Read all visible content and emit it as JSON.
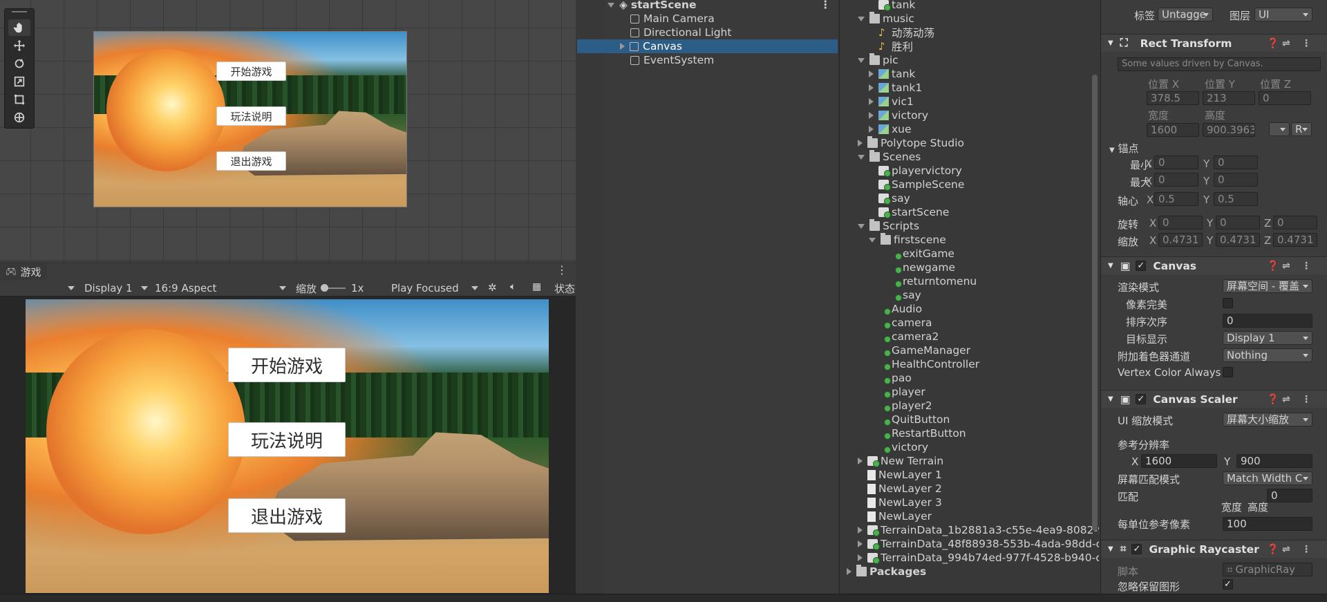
{
  "scene_view": {
    "buttons": [
      "开始游戏",
      "玩法说明",
      "退出游戏"
    ]
  },
  "game_view": {
    "tab_label": "游戏",
    "display": "Display 1",
    "aspect": "16:9 Aspect",
    "scale_label": "缩放",
    "scale_value": "1x",
    "play_mode": "Play Focused",
    "stats_label": "状态",
    "buttons": [
      "开始游戏",
      "玩法说明",
      "退出游戏"
    ]
  },
  "hierarchy": {
    "scene": "startScene",
    "items": [
      "Main Camera",
      "Directional Light",
      "Canvas",
      "EventSystem"
    ],
    "selected": "Canvas"
  },
  "project": {
    "items": [
      {
        "label": "tank",
        "type": "scene",
        "depth": 2
      },
      {
        "label": "music",
        "type": "folder",
        "depth": 1,
        "open": true
      },
      {
        "label": "动荡动荡",
        "type": "audio",
        "depth": 2
      },
      {
        "label": "胜利",
        "type": "audio",
        "depth": 2
      },
      {
        "label": "pic",
        "type": "folder",
        "depth": 1,
        "open": true
      },
      {
        "label": "tank",
        "type": "img",
        "depth": 2,
        "closed": true
      },
      {
        "label": "tank1",
        "type": "img",
        "depth": 2,
        "closed": true
      },
      {
        "label": "vic1",
        "type": "img",
        "depth": 2,
        "closed": true
      },
      {
        "label": "victory",
        "type": "img",
        "depth": 2,
        "closed": true
      },
      {
        "label": "xue",
        "type": "img",
        "depth": 2,
        "closed": true
      },
      {
        "label": "Polytope Studio",
        "type": "folder",
        "depth": 1,
        "closed": true
      },
      {
        "label": "Scenes",
        "type": "folder",
        "depth": 1,
        "open": true
      },
      {
        "label": "playervictory",
        "type": "scene",
        "depth": 2
      },
      {
        "label": "SampleScene",
        "type": "scene",
        "depth": 2
      },
      {
        "label": "say",
        "type": "scene",
        "depth": 2
      },
      {
        "label": "startScene",
        "type": "scene",
        "depth": 2
      },
      {
        "label": "Scripts",
        "type": "folder",
        "depth": 1,
        "open": true
      },
      {
        "label": "firstscene",
        "type": "folder",
        "depth": 2,
        "open": true
      },
      {
        "label": "exitGame",
        "type": "script",
        "depth": 3
      },
      {
        "label": "newgame",
        "type": "script",
        "depth": 3
      },
      {
        "label": "returntomenu",
        "type": "script",
        "depth": 3
      },
      {
        "label": "say",
        "type": "script",
        "depth": 3
      },
      {
        "label": "Audio",
        "type": "script",
        "depth": 2
      },
      {
        "label": "camera",
        "type": "script",
        "depth": 2
      },
      {
        "label": "camera2",
        "type": "script",
        "depth": 2
      },
      {
        "label": "GameManager",
        "type": "script",
        "depth": 2
      },
      {
        "label": "HealthController",
        "type": "script",
        "depth": 2
      },
      {
        "label": "pao",
        "type": "script",
        "depth": 2
      },
      {
        "label": "player",
        "type": "script",
        "depth": 2
      },
      {
        "label": "player2",
        "type": "script",
        "depth": 2
      },
      {
        "label": "QuitButton",
        "type": "script",
        "depth": 2
      },
      {
        "label": "RestartButton",
        "type": "script",
        "depth": 2
      },
      {
        "label": "victory",
        "type": "script",
        "depth": 2
      },
      {
        "label": "New Terrain",
        "type": "scene",
        "depth": 1,
        "closed": true
      },
      {
        "label": "NewLayer 1",
        "type": "file",
        "depth": 1
      },
      {
        "label": "NewLayer 2",
        "type": "file",
        "depth": 1
      },
      {
        "label": "NewLayer 3",
        "type": "file",
        "depth": 1
      },
      {
        "label": "NewLayer",
        "type": "file",
        "depth": 1
      },
      {
        "label": "TerrainData_1b2881a3-c55e-4ea9-8082-9",
        "type": "scene",
        "depth": 1,
        "closed": true
      },
      {
        "label": "TerrainData_48f88938-553b-4ada-98dd-c",
        "type": "scene",
        "depth": 1,
        "closed": true
      },
      {
        "label": "TerrainData_994b74ed-977f-4528-b940-c",
        "type": "scene",
        "depth": 1,
        "closed": true
      },
      {
        "label": "Packages",
        "type": "folder",
        "depth": 0,
        "closed": true,
        "bold": true
      }
    ]
  },
  "inspector": {
    "tag_label": "标签",
    "tag_value": "Untagge",
    "layer_label": "图层",
    "layer_value": "UI",
    "rect": {
      "title": "Rect Transform",
      "note": "Some values driven by Canvas.",
      "pos_x_label": "位置 X",
      "pos_y_label": "位置 Y",
      "pos_z_label": "位置 Z",
      "pos_x": "378.5",
      "pos_y": "213",
      "pos_z": "0",
      "w_label": "宽度",
      "h_label": "高度",
      "w": "1600",
      "h": "900.3963",
      "r_label": "R",
      "anchor_label": "锚点",
      "min_label": "最小",
      "max_label": "最大",
      "pivot_label": "轴心",
      "min_x": "0",
      "min_y": "0",
      "max_x": "0",
      "max_y": "0",
      "pivot_x": "0.5",
      "pivot_y": "0.5",
      "rot_label": "旋转",
      "rot_x": "0",
      "rot_y": "0",
      "rot_z": "0",
      "scale_label": "缩放",
      "scale_x": "0.4731",
      "scale_y": "0.4731",
      "scale_z": "0.4731"
    },
    "canvas": {
      "title": "Canvas",
      "render_mode_label": "渲染模式",
      "render_mode": "屏幕空间 - 覆盖",
      "pixel_perfect_label": "像素完美",
      "sort_order_label": "排序次序",
      "sort_order": "0",
      "target_display_label": "目标显示",
      "target_display": "Display 1",
      "shader_channels_label": "附加着色器通道",
      "shader_channels": "Nothing",
      "vertex_color_label": "Vertex Color Always"
    },
    "scaler": {
      "title": "Canvas Scaler",
      "ui_scale_label": "UI 缩放模式",
      "ui_scale": "屏幕大小缩放",
      "ref_res_label": "参考分辨率",
      "ref_x": "1600",
      "ref_y": "900",
      "match_mode_label": "屏幕匹配模式",
      "match_mode": "Match Width C",
      "match_label": "匹配",
      "match_value": "0",
      "width_label": "宽度",
      "height_label": "高度",
      "ppu_label": "每单位参考像素",
      "ppu": "100"
    },
    "raycaster": {
      "title": "Graphic Raycaster",
      "script_label": "脚本",
      "script_value": "GraphicRay",
      "ignore_label": "忽略保留图形"
    }
  }
}
